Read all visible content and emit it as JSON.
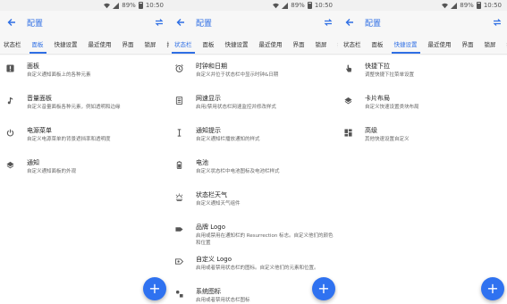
{
  "status": {
    "battery": "89%",
    "time": "10:50"
  },
  "app": {
    "title": "配置"
  },
  "screen1": {
    "tabs": [
      "状态栏",
      "面板",
      "快捷设置",
      "最近使用",
      "界面",
      "锁屏",
      "按钮"
    ],
    "active_tab": 1,
    "items": [
      {
        "title": "面板",
        "desc": "自定义通知面板上的各种元素",
        "icon": "alert-box-icon"
      },
      {
        "title": "音量面板",
        "desc": "自定义音量面板各种元素，例如透明和边缘",
        "icon": "music-note-icon"
      },
      {
        "title": "电源菜单",
        "desc": "自定义电源菜单的背景遮挡率和透明度",
        "icon": "power-icon"
      },
      {
        "title": "通知",
        "desc": "自定义通知面板的外观",
        "icon": "layers-icon"
      }
    ]
  },
  "screen2": {
    "tabs": [
      "状态栏",
      "面板",
      "快捷设置",
      "最近使用",
      "界面",
      "锁屏",
      "按钮"
    ],
    "active_tab": 0,
    "items": [
      {
        "title": "时钟和日期",
        "desc": "自定义并位于状态栏中显示时钟&日期",
        "icon": "alarm-clock-icon"
      },
      {
        "title": "网速显示",
        "desc": "启用/禁用状态栏网速监控并修改样式",
        "icon": "network-speed-icon"
      },
      {
        "title": "通知提示",
        "desc": "自定义通知栏播放通知的样式",
        "icon": "text-cursor-icon"
      },
      {
        "title": "电池",
        "desc": "自定义状态栏中电池图标及电池栏样式",
        "icon": "battery-icon"
      },
      {
        "title": "状态栏天气",
        "desc": "自定义通知天气组件",
        "icon": "weather-icon"
      },
      {
        "title": "品牌 Logo",
        "desc": "启用或禁用在通知栏的 Resurrection 标志。自定义他们的颜色和位置",
        "icon": "label-icon"
      },
      {
        "title": "自定义 Logo",
        "desc": "启用或者禁用状态栏的图标。自定义他们的元素和位置。",
        "icon": "custom-logo-icon"
      },
      {
        "title": "系统图标",
        "desc": "启用或者禁用状态栏图标",
        "icon": "system-icons-icon"
      }
    ]
  },
  "screen3": {
    "tabs": [
      "状态栏",
      "面板",
      "快捷设置",
      "最近使用",
      "界面",
      "锁屏",
      "按钮"
    ],
    "active_tab": 2,
    "items": [
      {
        "title": "快捷下拉",
        "desc": "调整快捷下拉菜单设置",
        "icon": "touch-hand-icon"
      },
      {
        "title": "卡片布局",
        "desc": "自定义快速设置类块布局",
        "icon": "layers-icon"
      },
      {
        "title": "高级",
        "desc": "其他快速设置自定义",
        "icon": "dashboard-icon"
      }
    ]
  },
  "colors": {
    "accent": "#2f6fe4",
    "fab": "#2f72f0"
  }
}
